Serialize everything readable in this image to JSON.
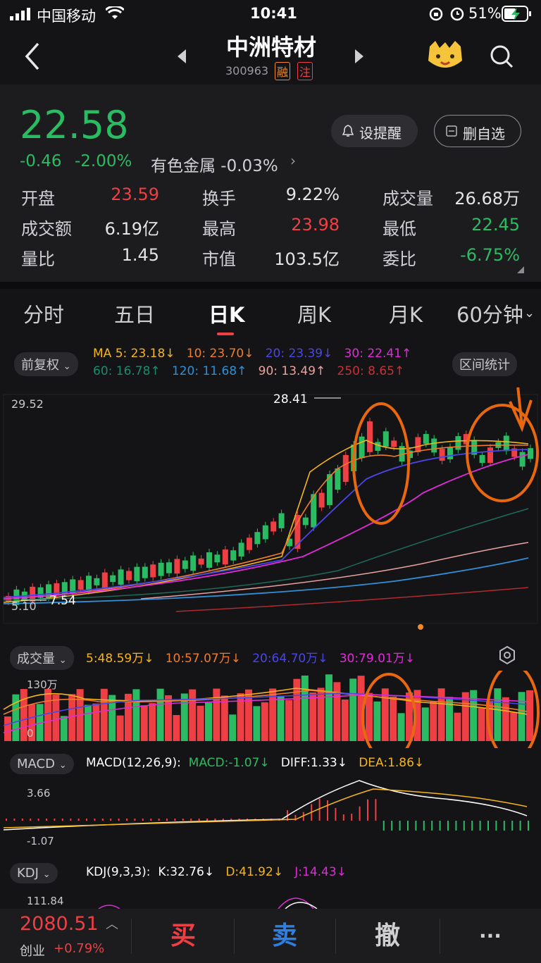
{
  "status_bar": {
    "carrier": "中国移动",
    "time": "10:41",
    "battery": "51%"
  },
  "header": {
    "title": "中洲特材",
    "code": "300963",
    "badge_rong": "融",
    "badge_zhu": "注"
  },
  "quote": {
    "price": "22.58",
    "change": "-0.46",
    "change_pct": "-2.00%",
    "sector": "有色金属 -0.03%",
    "alert_button": "设提醒",
    "remove_button": "删自选",
    "stats": [
      {
        "label": "开盘",
        "value": "23.59"
      },
      {
        "label": "换手",
        "value": "9.22%"
      },
      {
        "label": "成交量",
        "value": "26.68万"
      },
      {
        "label": "成交额",
        "value": "6.19亿"
      },
      {
        "label": "最高",
        "value": "23.98"
      },
      {
        "label": "最低",
        "value": "22.45"
      },
      {
        "label": "量比",
        "value": "1.45"
      },
      {
        "label": "市值",
        "value": "103.5亿"
      },
      {
        "label": "委比",
        "value": "-6.75%"
      }
    ]
  },
  "tabs": [
    "分时",
    "五日",
    "日K",
    "周K",
    "月K",
    "60分钟"
  ],
  "chart_controls": {
    "adjust": "前复权",
    "range_stats": "区间统计",
    "ma_line1": [
      "MA 5: 23.18↓",
      "10: 23.70↓",
      "20: 23.39↓",
      "30: 22.41↑"
    ],
    "ma_line2": [
      "60: 16.78↑",
      "120: 11.68↑",
      "90: 13.49↑",
      "250: 8.65↑"
    ],
    "price_top": "29.52",
    "price_bottom": "5.10",
    "high_label": "28.41",
    "low_label": "7.54"
  },
  "volume": {
    "label": "成交量",
    "items": [
      "5:48.59万↓",
      "10:57.07万↓",
      "20:64.70万↓",
      "30:79.01万↓"
    ],
    "axis_top": "130万",
    "axis_bottom": "0"
  },
  "macd": {
    "label": "MACD",
    "params": "MACD(12,26,9):",
    "macd": "MACD:-1.07↓",
    "diff": "DIFF:1.33↓",
    "dea": "DEA:1.86↓",
    "axis_top": "3.66",
    "axis_bottom": "-1.07"
  },
  "kdj": {
    "label": "KDJ",
    "params": "KDJ(9,3,3):",
    "k": "K:32.76↓",
    "d": "D:41.92↓",
    "j": "J:14.43↓",
    "axis_top": "111.84"
  },
  "bottom_bar": {
    "index_value": "2080.51",
    "index_name": "创业",
    "index_change": "+0.79%",
    "buy": "买",
    "sell": "卖",
    "cancel": "撤",
    "more": "···"
  },
  "colors": {
    "up": "#ee4044",
    "down": "#2bbb62",
    "ma5": "#f5b51b",
    "ma10": "#f07c2a",
    "ma20": "#4a46e8",
    "ma30": "#e02cd8",
    "annotation": "#e8670f"
  }
}
